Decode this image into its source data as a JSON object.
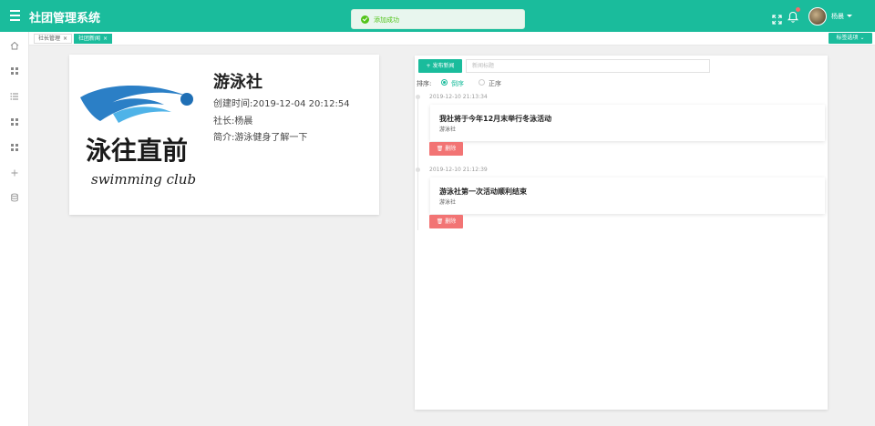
{
  "header": {
    "app_title": "社团管理系统",
    "user_name": "杨晨",
    "icons": [
      "menu-icon",
      "fullscreen-icon",
      "bell-icon"
    ],
    "accent_color": "#1abc9c"
  },
  "toast": {
    "message": "添加成功",
    "type": "success",
    "color": "#52c41a"
  },
  "sidebar": {
    "icons": [
      "home-icon",
      "grid-icon",
      "list-icon",
      "grid-icon",
      "grid-icon",
      "plus-icon",
      "database-icon"
    ]
  },
  "tabs": {
    "items": [
      {
        "label": "社长管理",
        "active": false
      },
      {
        "label": "社团新闻",
        "active": true
      }
    ],
    "close_glyph": "×",
    "options_label": "标签选项"
  },
  "club": {
    "name": "游泳社",
    "created": "创建时间:2019-12-04 20:12:54",
    "president": "社长:杨晨",
    "intro": "简介:游泳健身了解一下",
    "logo_text_cn": "泳往直前",
    "logo_text_en": "swimming club"
  },
  "news": {
    "publish_label": "发布新闻",
    "search_placeholder": "新闻标题",
    "sort_label": "排序:",
    "sort_options": [
      {
        "label": "倒序",
        "checked": true
      },
      {
        "label": "正序",
        "checked": false
      }
    ],
    "items": [
      {
        "time": "2019-12-10 21:13:34",
        "title": "我社将于今年12月末举行冬泳活动",
        "club": "游泳社"
      },
      {
        "time": "2019-12-10 21:12:39",
        "title": "游泳社第一次活动顺利结束",
        "club": "游泳社"
      }
    ],
    "delete_label": "删除",
    "delete_color": "#f27474"
  }
}
